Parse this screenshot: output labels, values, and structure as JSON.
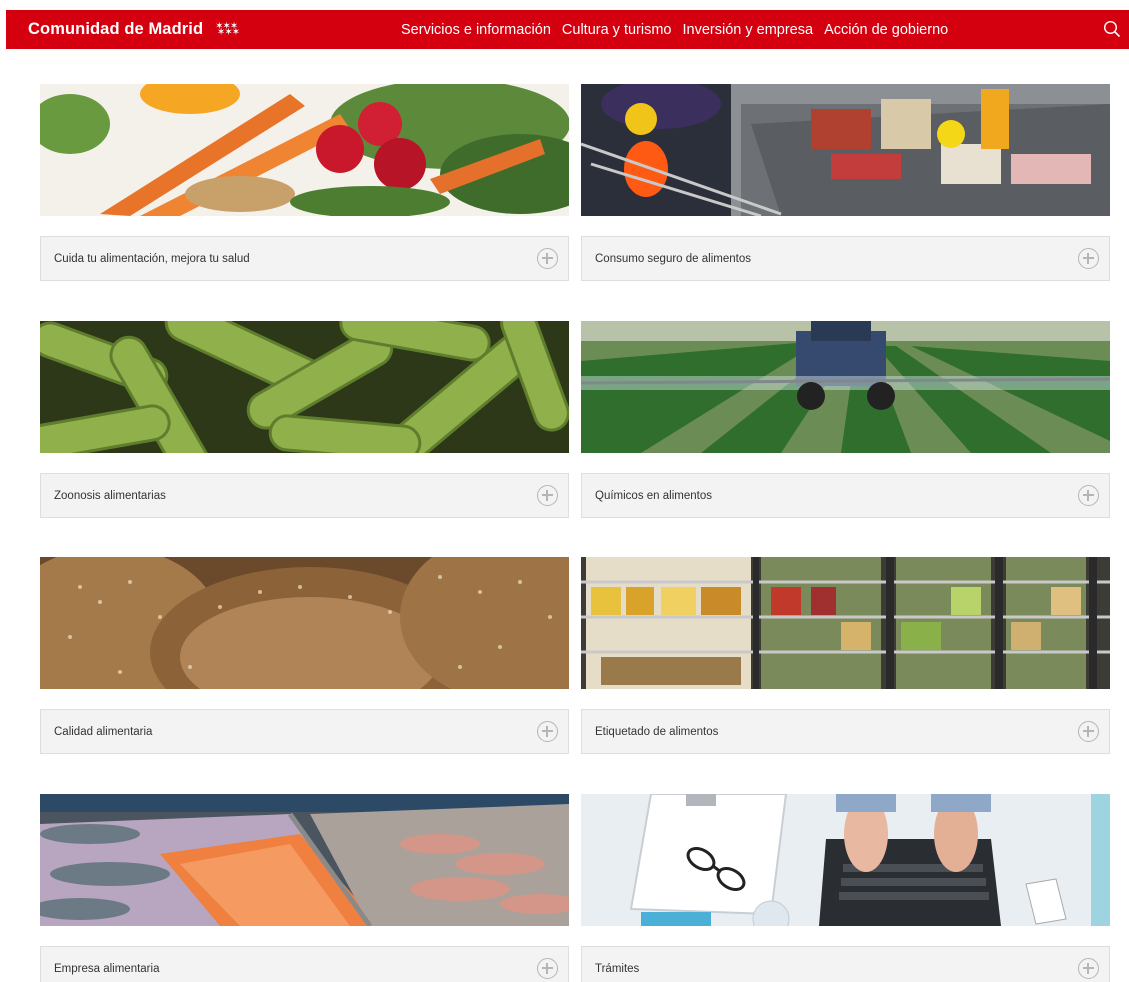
{
  "header": {
    "brand": "Comunidad de Madrid",
    "nav": [
      "Servicios e información",
      "Cultura y turismo",
      "Inversión y empresa",
      "Acción de gobierno"
    ]
  },
  "cards": [
    {
      "label": "Cuida tu alimentación, mejora tu salud",
      "image": "vegetables-photo"
    },
    {
      "label": "Consumo seguro de alimentos",
      "image": "supermarket-checkout-photo"
    },
    {
      "label": "Zoonosis alimentarias",
      "image": "bacteria-photo"
    },
    {
      "label": "Químicos en alimentos",
      "image": "crop-spraying-photo"
    },
    {
      "label": "Calidad alimentaria",
      "image": "bread-photo"
    },
    {
      "label": "Etiquetado de alimentos",
      "image": "supermarket-shelves-photo"
    },
    {
      "label": "Empresa alimentaria",
      "image": "fish-market-photo"
    },
    {
      "label": "Trámites",
      "image": "laptop-desk-photo"
    }
  ],
  "colors": {
    "brand": "#d4000f",
    "bar": "#f3f3f3"
  },
  "icons": {
    "search": "search-icon",
    "expand": "plus-circle-icon"
  }
}
